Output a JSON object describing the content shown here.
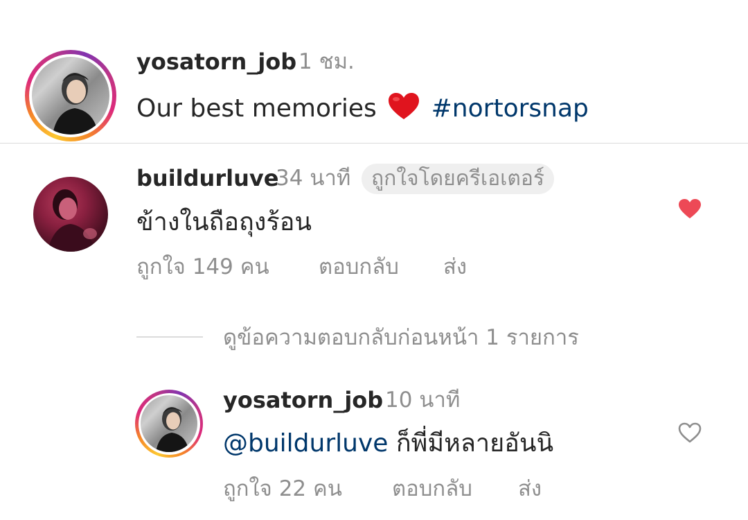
{
  "post": {
    "username": "yosatorn_job",
    "time": "1 ชม.",
    "caption_text": "Our best memories",
    "caption_emoji": "heart-emoji",
    "hashtag": "#nortorsnap"
  },
  "comment": {
    "username": "buildurluve",
    "time": "34 นาที",
    "badge": "ถูกใจโดยครีเอเตอร์",
    "text": "ข้างในถือถุงร้อน",
    "likes": "ถูกใจ 149 คน",
    "reply_label": "ตอบกลับ",
    "send_label": "ส่ง",
    "liked": true,
    "like_color": "#ed4956"
  },
  "view_replies": {
    "label": "ดูข้อความตอบกลับก่อนหน้า 1 รายการ"
  },
  "reply": {
    "username": "yosatorn_job",
    "time": "10 นาที",
    "mention": "@buildurluve",
    "text": "ก็พี่มีหลายอันนิ",
    "likes": "ถูกใจ 22 คน",
    "reply_label": "ตอบกลับ",
    "send_label": "ส่ง",
    "liked": false
  }
}
